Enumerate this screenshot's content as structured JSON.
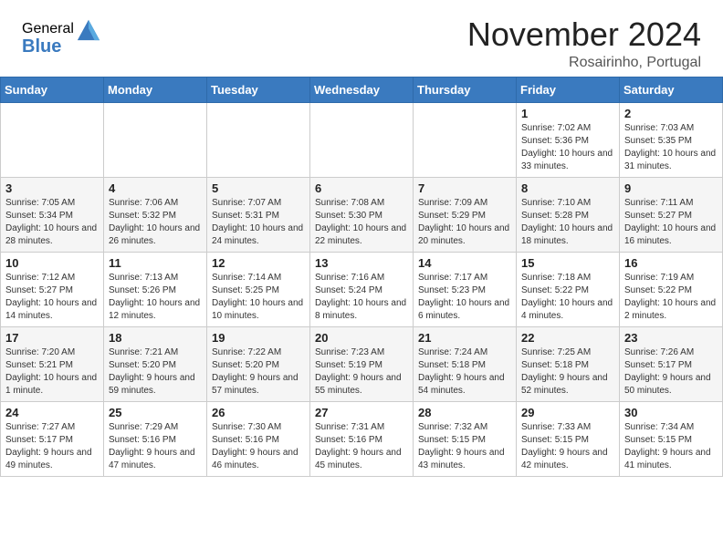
{
  "header": {
    "logo_general": "General",
    "logo_blue": "Blue",
    "month_title": "November 2024",
    "subtitle": "Rosairinho, Portugal"
  },
  "weekdays": [
    "Sunday",
    "Monday",
    "Tuesday",
    "Wednesday",
    "Thursday",
    "Friday",
    "Saturday"
  ],
  "weeks": [
    [
      {
        "day": "",
        "info": ""
      },
      {
        "day": "",
        "info": ""
      },
      {
        "day": "",
        "info": ""
      },
      {
        "day": "",
        "info": ""
      },
      {
        "day": "",
        "info": ""
      },
      {
        "day": "1",
        "info": "Sunrise: 7:02 AM\nSunset: 5:36 PM\nDaylight: 10 hours\nand 33 minutes."
      },
      {
        "day": "2",
        "info": "Sunrise: 7:03 AM\nSunset: 5:35 PM\nDaylight: 10 hours\nand 31 minutes."
      }
    ],
    [
      {
        "day": "3",
        "info": "Sunrise: 7:05 AM\nSunset: 5:34 PM\nDaylight: 10 hours\nand 28 minutes."
      },
      {
        "day": "4",
        "info": "Sunrise: 7:06 AM\nSunset: 5:32 PM\nDaylight: 10 hours\nand 26 minutes."
      },
      {
        "day": "5",
        "info": "Sunrise: 7:07 AM\nSunset: 5:31 PM\nDaylight: 10 hours\nand 24 minutes."
      },
      {
        "day": "6",
        "info": "Sunrise: 7:08 AM\nSunset: 5:30 PM\nDaylight: 10 hours\nand 22 minutes."
      },
      {
        "day": "7",
        "info": "Sunrise: 7:09 AM\nSunset: 5:29 PM\nDaylight: 10 hours\nand 20 minutes."
      },
      {
        "day": "8",
        "info": "Sunrise: 7:10 AM\nSunset: 5:28 PM\nDaylight: 10 hours\nand 18 minutes."
      },
      {
        "day": "9",
        "info": "Sunrise: 7:11 AM\nSunset: 5:27 PM\nDaylight: 10 hours\nand 16 minutes."
      }
    ],
    [
      {
        "day": "10",
        "info": "Sunrise: 7:12 AM\nSunset: 5:27 PM\nDaylight: 10 hours\nand 14 minutes."
      },
      {
        "day": "11",
        "info": "Sunrise: 7:13 AM\nSunset: 5:26 PM\nDaylight: 10 hours\nand 12 minutes."
      },
      {
        "day": "12",
        "info": "Sunrise: 7:14 AM\nSunset: 5:25 PM\nDaylight: 10 hours\nand 10 minutes."
      },
      {
        "day": "13",
        "info": "Sunrise: 7:16 AM\nSunset: 5:24 PM\nDaylight: 10 hours\nand 8 minutes."
      },
      {
        "day": "14",
        "info": "Sunrise: 7:17 AM\nSunset: 5:23 PM\nDaylight: 10 hours\nand 6 minutes."
      },
      {
        "day": "15",
        "info": "Sunrise: 7:18 AM\nSunset: 5:22 PM\nDaylight: 10 hours\nand 4 minutes."
      },
      {
        "day": "16",
        "info": "Sunrise: 7:19 AM\nSunset: 5:22 PM\nDaylight: 10 hours\nand 2 minutes."
      }
    ],
    [
      {
        "day": "17",
        "info": "Sunrise: 7:20 AM\nSunset: 5:21 PM\nDaylight: 10 hours\nand 1 minute."
      },
      {
        "day": "18",
        "info": "Sunrise: 7:21 AM\nSunset: 5:20 PM\nDaylight: 9 hours\nand 59 minutes."
      },
      {
        "day": "19",
        "info": "Sunrise: 7:22 AM\nSunset: 5:20 PM\nDaylight: 9 hours\nand 57 minutes."
      },
      {
        "day": "20",
        "info": "Sunrise: 7:23 AM\nSunset: 5:19 PM\nDaylight: 9 hours\nand 55 minutes."
      },
      {
        "day": "21",
        "info": "Sunrise: 7:24 AM\nSunset: 5:18 PM\nDaylight: 9 hours\nand 54 minutes."
      },
      {
        "day": "22",
        "info": "Sunrise: 7:25 AM\nSunset: 5:18 PM\nDaylight: 9 hours\nand 52 minutes."
      },
      {
        "day": "23",
        "info": "Sunrise: 7:26 AM\nSunset: 5:17 PM\nDaylight: 9 hours\nand 50 minutes."
      }
    ],
    [
      {
        "day": "24",
        "info": "Sunrise: 7:27 AM\nSunset: 5:17 PM\nDaylight: 9 hours\nand 49 minutes."
      },
      {
        "day": "25",
        "info": "Sunrise: 7:29 AM\nSunset: 5:16 PM\nDaylight: 9 hours\nand 47 minutes."
      },
      {
        "day": "26",
        "info": "Sunrise: 7:30 AM\nSunset: 5:16 PM\nDaylight: 9 hours\nand 46 minutes."
      },
      {
        "day": "27",
        "info": "Sunrise: 7:31 AM\nSunset: 5:16 PM\nDaylight: 9 hours\nand 45 minutes."
      },
      {
        "day": "28",
        "info": "Sunrise: 7:32 AM\nSunset: 5:15 PM\nDaylight: 9 hours\nand 43 minutes."
      },
      {
        "day": "29",
        "info": "Sunrise: 7:33 AM\nSunset: 5:15 PM\nDaylight: 9 hours\nand 42 minutes."
      },
      {
        "day": "30",
        "info": "Sunrise: 7:34 AM\nSunset: 5:15 PM\nDaylight: 9 hours\nand 41 minutes."
      }
    ]
  ]
}
